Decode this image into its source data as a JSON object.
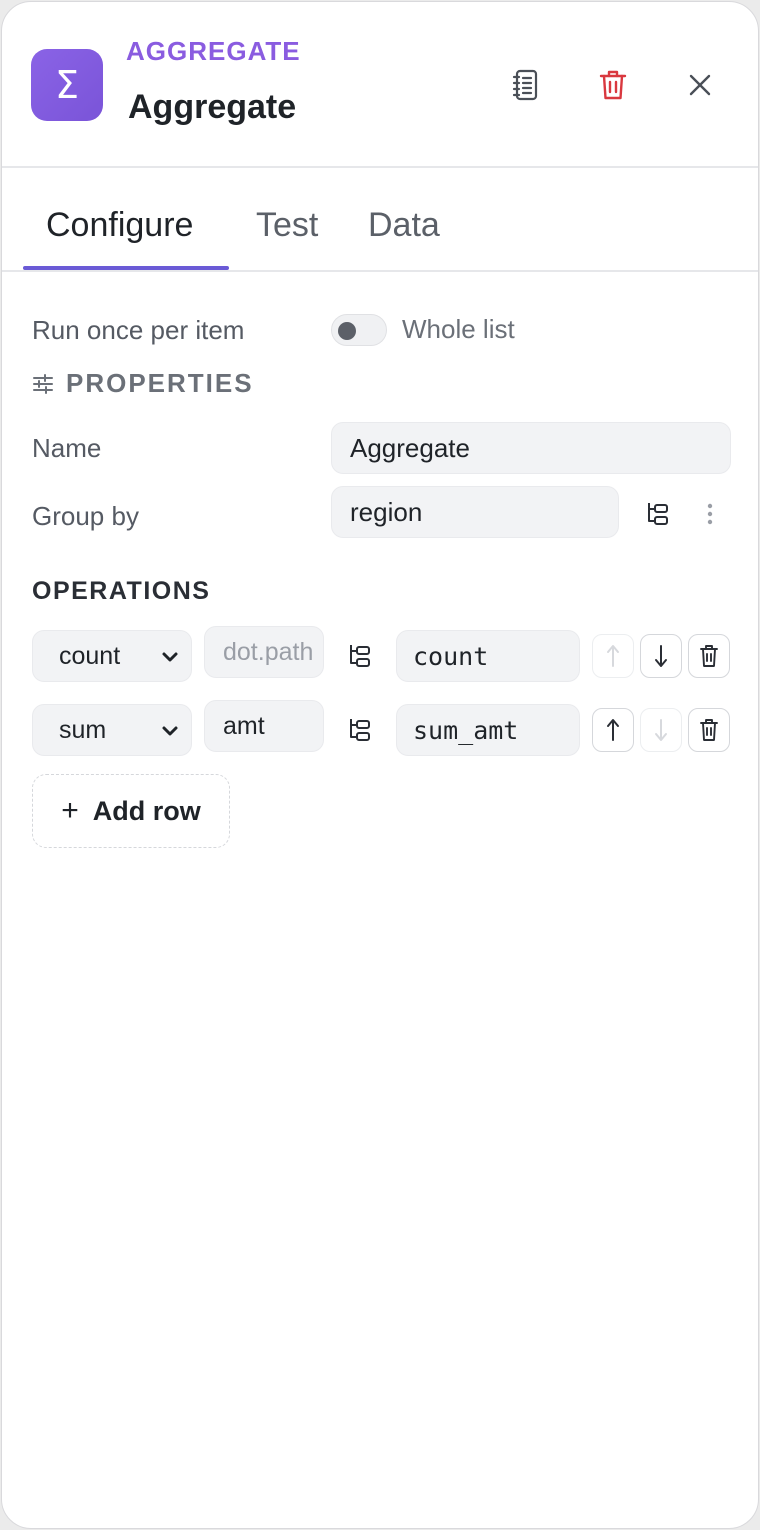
{
  "header": {
    "node_type": "AGGREGATE",
    "title": "Aggregate",
    "icon_glyph": "Σ",
    "accent_color": "#8a5ce0",
    "delete_color": "#d9383f"
  },
  "tabs": [
    {
      "label": "Configure",
      "active": true
    },
    {
      "label": "Test",
      "active": false
    },
    {
      "label": "Data",
      "active": false
    }
  ],
  "mode": {
    "label": "Run once per item",
    "toggle_label": "Whole list",
    "toggle_on": false
  },
  "properties": {
    "heading": "PROPERTIES",
    "name_label": "Name",
    "name_value": "Aggregate",
    "group_by_label": "Group by",
    "group_by_value": "region"
  },
  "operations": {
    "heading": "OPERATIONS",
    "rows": [
      {
        "op": "count",
        "path": "",
        "path_placeholder": "dot.path",
        "output": "count"
      },
      {
        "op": "sum",
        "path": "amt",
        "path_placeholder": "dot.path",
        "output": "sum_amt"
      }
    ],
    "add_label": "Add row"
  }
}
